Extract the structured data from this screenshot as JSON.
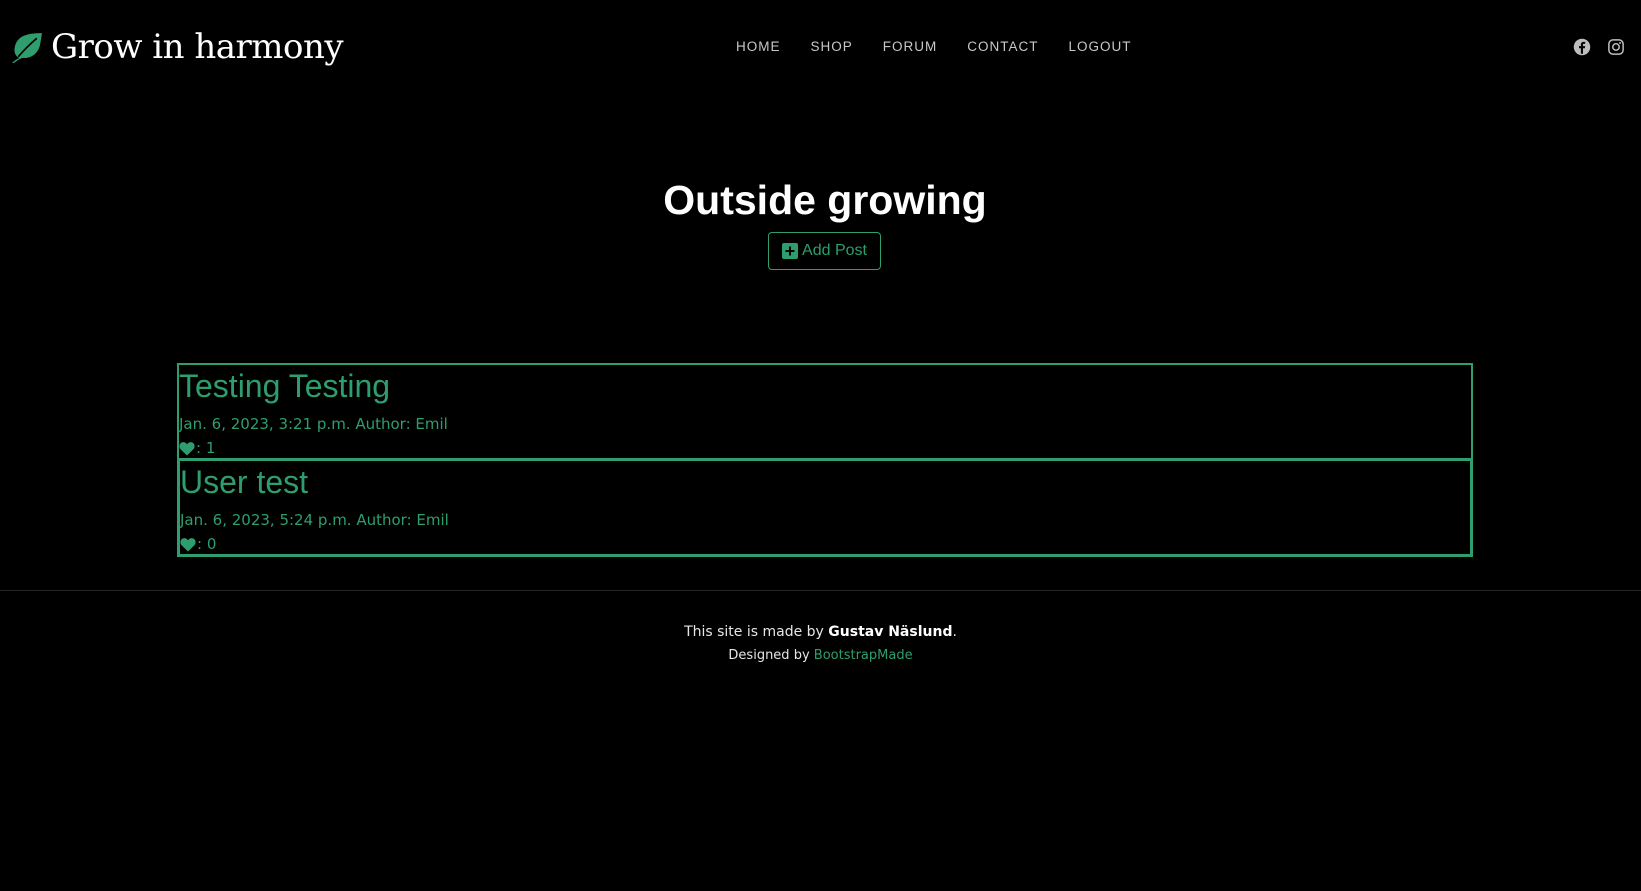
{
  "header": {
    "logo_text": "Grow in harmony",
    "logo_icon": "leaf-icon",
    "nav": [
      {
        "label": "HOME"
      },
      {
        "label": "SHOP"
      },
      {
        "label": "FORUM"
      },
      {
        "label": "CONTACT"
      },
      {
        "label": "LOGOUT"
      }
    ],
    "social": [
      "facebook-icon",
      "instagram-icon"
    ]
  },
  "main": {
    "title": "Outside growing",
    "add_post_label": "Add Post",
    "add_post_icon": "plus-square-icon",
    "posts": [
      {
        "title": "Testing Testing",
        "meta": "Jan. 6, 2023, 3:21 p.m. Author: Emil",
        "likes": ": 1"
      },
      {
        "title": "User test",
        "meta": "Jan. 6, 2023, 5:24 p.m. Author: Emil",
        "likes": ": 0"
      }
    ]
  },
  "footer": {
    "made_by_prefix": "This site is made by ",
    "made_by_name": "Gustav Näslund",
    "made_by_suffix": ".",
    "designed_prefix": "Designed by ",
    "designed_link": "BootstrapMade"
  },
  "colors": {
    "background": "#000000",
    "accent": "#2e9e6e",
    "text": "#ffffff",
    "nav_text": "#c8c8c8"
  }
}
